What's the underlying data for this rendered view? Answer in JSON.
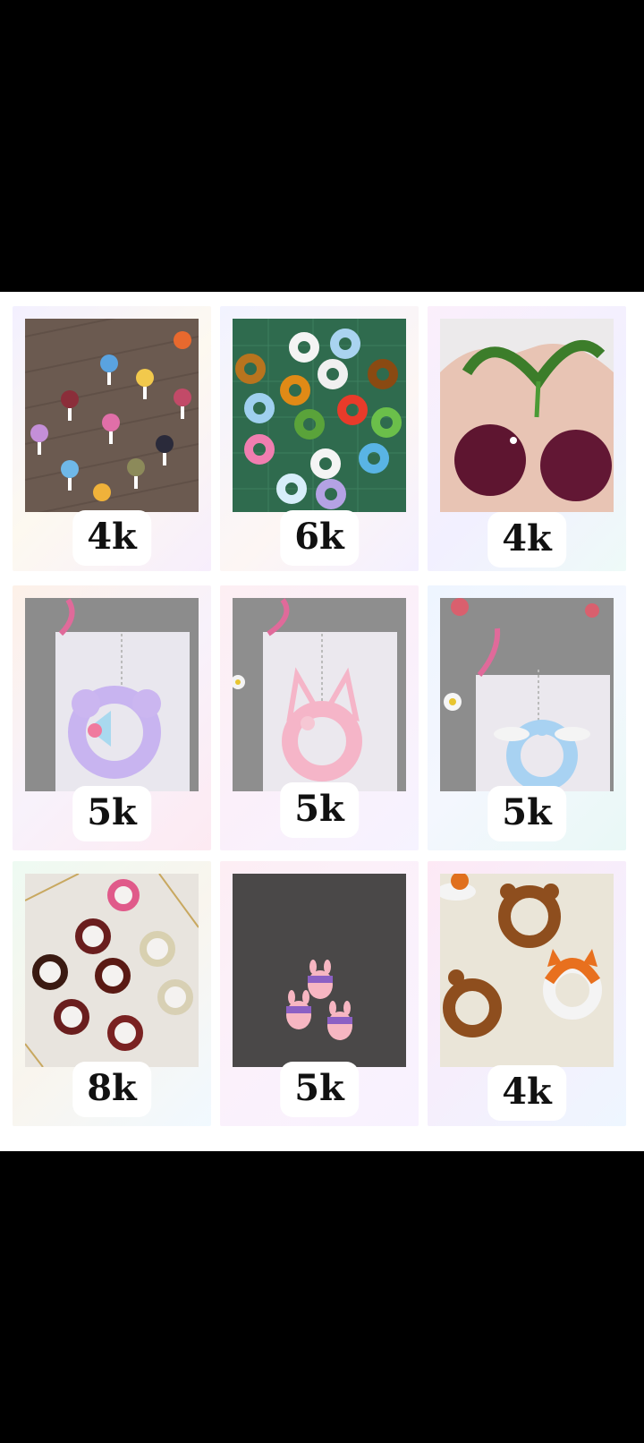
{
  "cards": [
    {
      "id": "lollipop-keychains",
      "views": "4k",
      "bg": "linear-gradient(135deg,#f3f0ff 0%,#fdf9f0 50%,#f7eefc 100%)"
    },
    {
      "id": "animal-wreath-charms",
      "views": "6k",
      "bg": "linear-gradient(135deg,#f2f3ff 0%,#fdf6f4 60%,#f4f0ff 100%)"
    },
    {
      "id": "cherry-pipe-cleaner",
      "views": "4k",
      "bg": "linear-gradient(135deg,#fbeffb 0%,#f2f0ff 55%,#eefaf8 100%)"
    },
    {
      "id": "purple-mouse-keychain",
      "views": "5k",
      "bg": "linear-gradient(135deg,#fdf1e8 0%,#f8f2fb 50%,#fdeaf2 100%)"
    },
    {
      "id": "pink-cat-keychain",
      "views": "5k",
      "bg": "linear-gradient(135deg,#fdeff3 0%,#fbf0fa 50%,#f6f3ff 100%)"
    },
    {
      "id": "blue-puppy-keychain",
      "views": "5k",
      "bg": "linear-gradient(135deg,#eef5ff 0%,#f4f7fe 50%,#e9f8f6 100%)"
    },
    {
      "id": "bear-mirror-charms",
      "views": "8k",
      "bg": "linear-gradient(135deg,#eefaf2 0%,#f9f5ee 50%,#f1f9ff 100%)"
    },
    {
      "id": "pink-bunny-charms",
      "views": "5k",
      "bg": "linear-gradient(135deg,#fdeef4 0%,#fbf1fb 50%,#f8f2ff 100%)"
    },
    {
      "id": "bear-fox-rings",
      "views": "4k",
      "bg": "linear-gradient(135deg,#fde9f5 0%,#f6eefc 50%,#eef6ff 100%)"
    }
  ]
}
